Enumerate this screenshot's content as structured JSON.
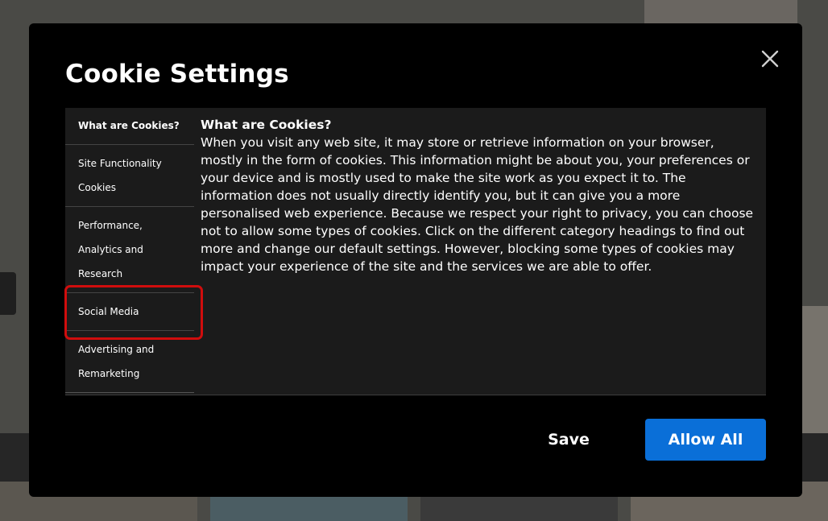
{
  "modal": {
    "title": "Cookie Settings",
    "close_icon": "close-icon",
    "nav": [
      "What are Cookies?",
      "Site Functionality\nCookies",
      "Performance,\nAnalytics and\nResearch",
      "Social Media",
      "Advertising and\nRemarketing"
    ],
    "active_nav": "What are Cookies?",
    "highlighted_nav": "Social Media",
    "content": {
      "heading": "What are Cookies?",
      "body": "When you visit any web site, it may store or retrieve information on your browser, mostly in the form of cookies. This information might be about you, your preferences or your device and is mostly used to make the site work as you expect it to. The information does not usually directly identify you, but it can give you a more personalised web experience. Because we respect your right to privacy, you can choose not to allow some types of cookies. Click on the different category headings to find out more and change our default settings. However, blocking some types of cookies may impact your experience of the site and the services we are able to offer."
    },
    "buttons": {
      "save": "Save",
      "allow_all": "Allow All"
    }
  },
  "colors": {
    "accent": "#0a6fd8",
    "highlight_border": "#d00d0d",
    "modal_bg": "#000000",
    "panel_bg": "#1b1b1b"
  }
}
